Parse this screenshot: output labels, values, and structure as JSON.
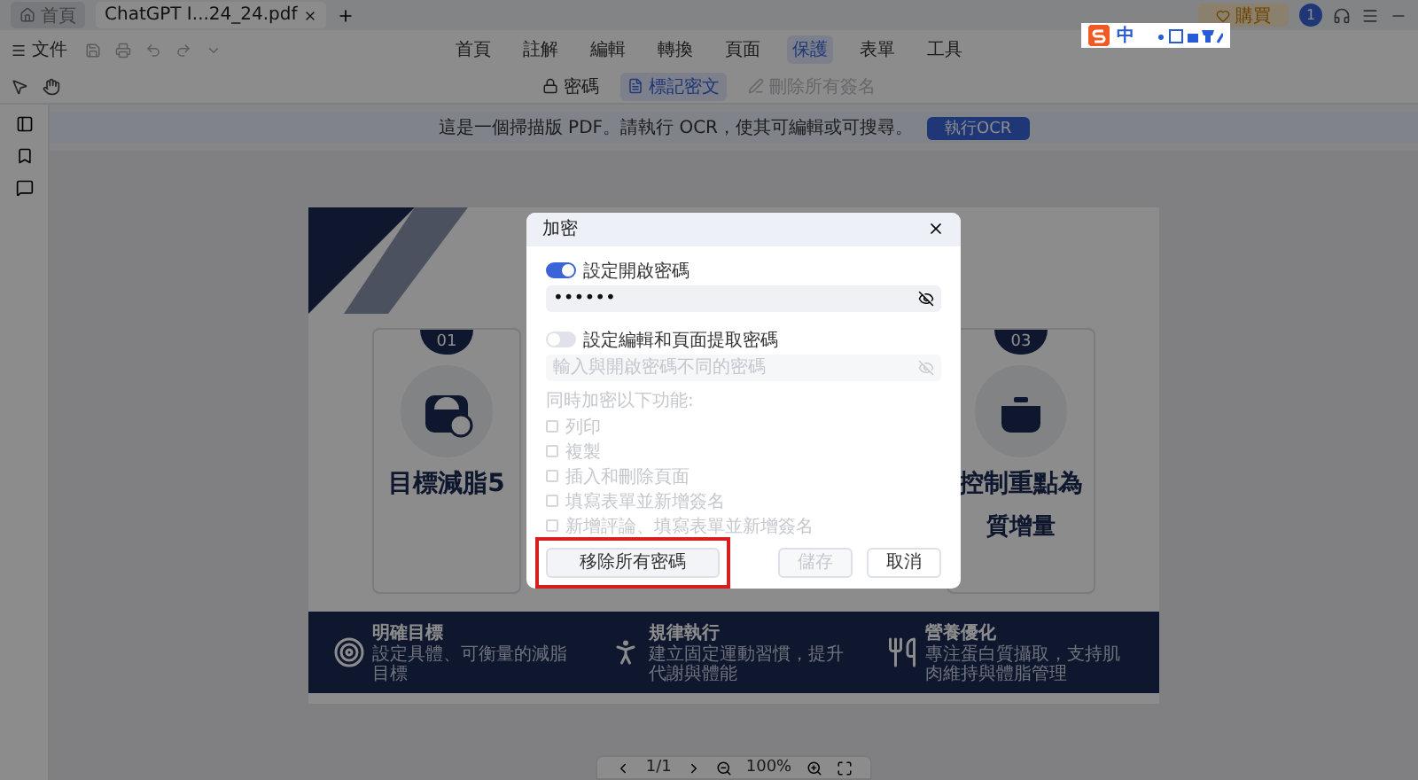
{
  "tabs": [
    {
      "kind": "home",
      "label": "首頁",
      "selected": false
    },
    {
      "kind": "document",
      "label": "ChatGPT I...24_24.pdf",
      "selected": true
    }
  ],
  "account": {
    "upgrade": "購買",
    "avatar": "1"
  },
  "ime_bar": {
    "label": "中"
  },
  "file_menu": "文件",
  "menus": [
    {
      "label": "首頁",
      "selected": false
    },
    {
      "label": "註解",
      "selected": false
    },
    {
      "label": "編輯",
      "selected": false
    },
    {
      "label": "轉換",
      "selected": false
    },
    {
      "label": "頁面",
      "selected": false
    },
    {
      "label": "保護",
      "selected": true
    },
    {
      "label": "表單",
      "selected": false
    },
    {
      "label": "工具",
      "selected": false
    }
  ],
  "sub_tools": [
    {
      "kind": "lock",
      "label": "密碼",
      "selected": false,
      "disabled": false
    },
    {
      "kind": "redact",
      "label": "標記密文",
      "selected": true,
      "disabled": false
    },
    {
      "kind": "signature",
      "label": "刪除所有簽名",
      "selected": false,
      "disabled": true
    }
  ],
  "ocr_banner": {
    "message": "這是一個掃描版 PDF。請執行 OCR，使其可編輯或可搜尋。",
    "button": "執行OCR"
  },
  "document": {
    "cards": [
      {
        "number": "01",
        "title": "目標減脂5"
      },
      {
        "number": "03",
        "title": "控制重點為",
        "subtitle": "質增量"
      }
    ],
    "band": [
      {
        "kind": "target",
        "title": "明確目標",
        "text": "設定具體、可衡量的減脂目標"
      },
      {
        "kind": "run",
        "title": "規律執行",
        "text": "建立固定運動習慣，提升代謝與體能"
      },
      {
        "kind": "meal",
        "title": "營養優化",
        "text": "專注蛋白質攝取，支持肌肉維持與體脂管理"
      }
    ]
  },
  "page_controls": {
    "page": "1/1",
    "zoom": "100%"
  },
  "dialog": {
    "title": "加密",
    "open_password": {
      "label": "設定開啟密碼",
      "on": true,
      "value": "••••••"
    },
    "edit_password": {
      "label": "設定編輯和頁面提取密碼",
      "on": false,
      "placeholder": "輸入與開啟密碼不同的密碼"
    },
    "restrict_label": "同時加密以下功能:",
    "options": [
      {
        "label": "列印",
        "checked": false,
        "disabled": true
      },
      {
        "label": "複製",
        "checked": false,
        "disabled": true
      },
      {
        "label": "插入和刪除頁面",
        "checked": false,
        "disabled": true
      },
      {
        "label": "填寫表單並新增簽名",
        "checked": false,
        "disabled": true
      },
      {
        "label": "新增評論、填寫表單並新增簽名",
        "checked": false,
        "disabled": true
      }
    ],
    "buttons": [
      {
        "kind": "remove",
        "label": "移除所有密碼",
        "disabled": false,
        "highlighted": true
      },
      {
        "kind": "save",
        "label": "儲存",
        "disabled": true
      },
      {
        "kind": "cancel",
        "label": "取消",
        "disabled": false
      }
    ]
  }
}
